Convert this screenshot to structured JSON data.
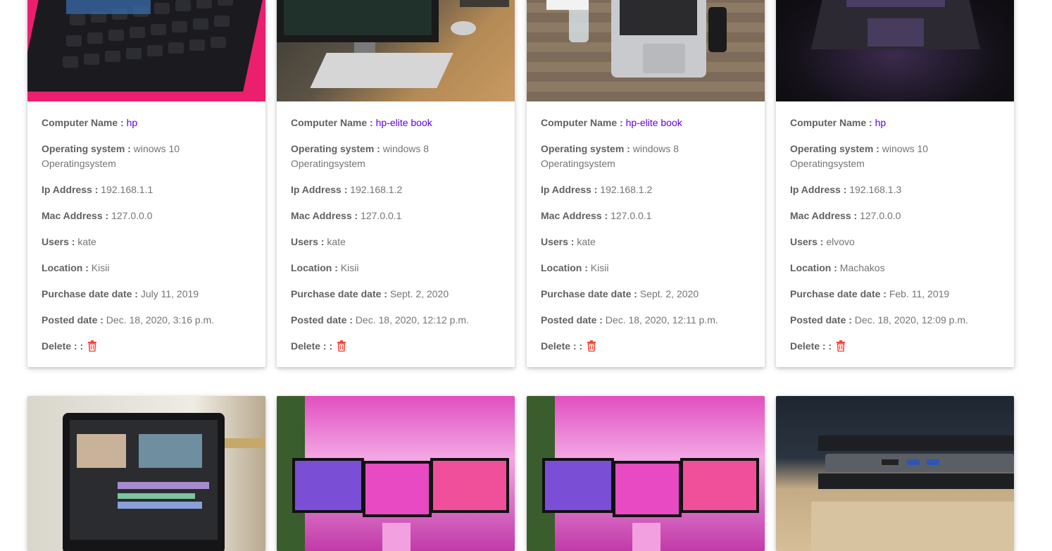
{
  "labels": {
    "name": "Computer Name :",
    "os": "Operating system :",
    "ip": "Ip Address :",
    "mac": "Mac Address :",
    "users": "Users :",
    "location": "Location :",
    "purchase": "Purchase date date :",
    "posted": "Posted date :",
    "delete": "Delete : :"
  },
  "cards": [
    {
      "name": "hp",
      "os": "winows 10 Operatingsystem",
      "ip": "192.168.1.1",
      "mac": "127.0.0.0",
      "users": "kate",
      "location": "Kisii",
      "purchase": "July 11, 2019",
      "posted": "Dec. 18, 2020, 3:16 p.m."
    },
    {
      "name": "hp-elite book",
      "os": "windows 8 Operatingsystem",
      "ip": "192.168.1.2",
      "mac": "127.0.0.1",
      "users": "kate",
      "location": "Kisii",
      "purchase": "Sept. 2, 2020",
      "posted": "Dec. 18, 2020, 12:12 p.m."
    },
    {
      "name": "hp-elite book",
      "os": "windows 8 Operatingsystem",
      "ip": "192.168.1.2",
      "mac": "127.0.0.1",
      "users": "kate",
      "location": "Kisii",
      "purchase": "Sept. 2, 2020",
      "posted": "Dec. 18, 2020, 12:11 p.m."
    },
    {
      "name": "hp",
      "os": "winows 10 Operatingsystem",
      "ip": "192.168.1.3",
      "mac": "127.0.0.0",
      "users": "elvovo",
      "location": "Machakos",
      "purchase": "Feb. 11, 2019",
      "posted": "Dec. 18, 2020, 12:09 p.m."
    }
  ],
  "colors": {
    "name_link": "#6200ea",
    "delete_icon": "#f44336",
    "label": "#616161",
    "value": "#757575"
  },
  "icons": {
    "delete": "trash-icon"
  }
}
